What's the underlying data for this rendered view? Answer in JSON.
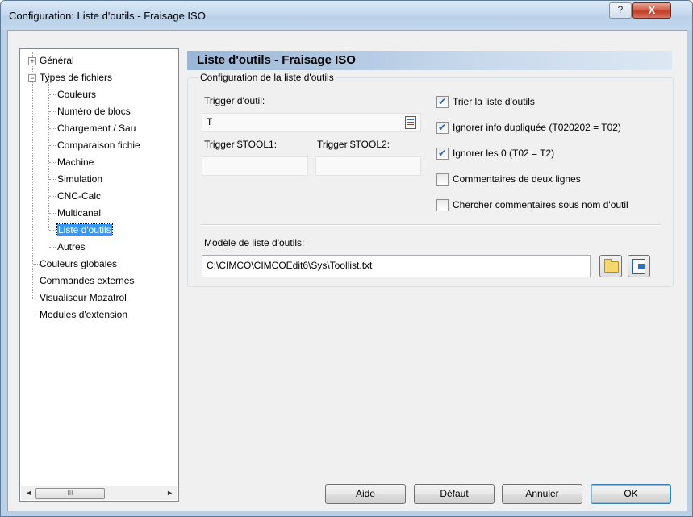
{
  "window": {
    "title": "Configuration: Liste d'outils - Fraisage ISO",
    "help_label": "?",
    "close_label": "X"
  },
  "tree": {
    "items": [
      {
        "label": "Général",
        "expander": "+"
      },
      {
        "label": "Types de fichiers",
        "expander": "−"
      },
      {
        "label": "Couleurs"
      },
      {
        "label": "Numéro de blocs"
      },
      {
        "label": "Chargement / Sau"
      },
      {
        "label": "Comparaison fichie"
      },
      {
        "label": "Machine"
      },
      {
        "label": "Simulation"
      },
      {
        "label": "CNC-Calc"
      },
      {
        "label": "Multicanal"
      },
      {
        "label": "Liste d'outils",
        "selected": true
      },
      {
        "label": "Autres"
      },
      {
        "label": "Couleurs globales"
      },
      {
        "label": "Commandes externes"
      },
      {
        "label": "Visualiseur Mazatrol"
      },
      {
        "label": "Modules d'extension"
      }
    ],
    "scroll_left": "◄",
    "scroll_right": "►",
    "scroll_thumb": "III"
  },
  "panel": {
    "title": "Liste d'outils - Fraisage ISO",
    "group_title": "Configuration de la liste d'outils",
    "trigger_label": "Trigger d'outil:",
    "trigger_value": "T",
    "tool1_label": "Trigger $TOOL1:",
    "tool2_label": "Trigger $TOOL2:",
    "tool1_value": "",
    "tool2_value": "",
    "checkboxes": [
      {
        "label": "Trier la liste d'outils",
        "checked": true
      },
      {
        "label": "Ignorer info dupliquée (T020202 = T02)",
        "checked": true
      },
      {
        "label": "Ignorer les 0 (T02 = T2)",
        "checked": true
      },
      {
        "label": "Commentaires de deux lignes",
        "checked": false
      },
      {
        "label": "Chercher commentaires sous nom d'outil",
        "checked": false
      }
    ],
    "template_label": "Modèle de liste d'outils:",
    "template_path": "C:\\CIMCO\\CIMCOEdit6\\Sys\\Toollist.txt"
  },
  "buttons": {
    "help": "Aide",
    "default": "Défaut",
    "cancel": "Annuler",
    "ok": "OK"
  }
}
